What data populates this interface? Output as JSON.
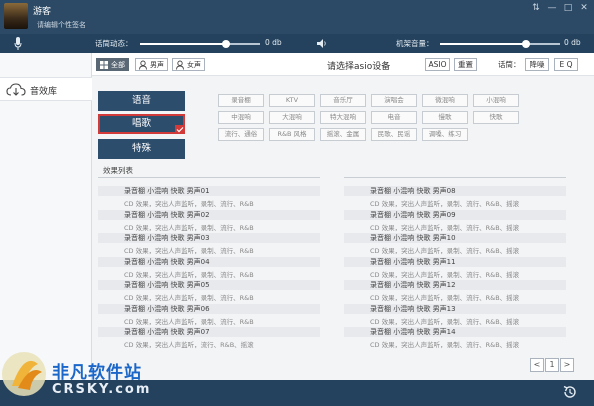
{
  "user": {
    "name": "游客",
    "signature": "请编辑个性签名"
  },
  "window_controls": [
    "⇅",
    "—",
    "□",
    "✕"
  ],
  "controls": {
    "reverb_label": "话筒动态：",
    "reverb_value": "0 db",
    "reverb_level": 0.72,
    "machine_label": "机架音量：",
    "machine_value": "0 db",
    "machine_level": 0.72
  },
  "sidebar": {
    "item_label": "音效库"
  },
  "filters": [
    {
      "label": "全部",
      "active": true,
      "icon": "all-icon"
    },
    {
      "label": "男声",
      "active": false,
      "icon": "male-icon"
    },
    {
      "label": "女声",
      "active": false,
      "icon": "female-icon"
    }
  ],
  "toolbar": {
    "asio_title": "请选择asio设备",
    "asio_button": "ASIO",
    "reset_button": "重置",
    "mic_label": "话筒：",
    "noise_button": "降噪",
    "eq_button": "E Q"
  },
  "categories": [
    {
      "label": "语音",
      "selected": false
    },
    {
      "label": "唱歌",
      "selected": true
    },
    {
      "label": "特殊",
      "selected": false
    }
  ],
  "tags": [
    [
      "录音棚",
      "KTV",
      "音乐厅",
      "演唱会",
      "微混响",
      "小混响"
    ],
    [
      "中混响",
      "大混响",
      "特大混响",
      "电音",
      "慢歌",
      "快歌"
    ],
    [
      "流行、通俗",
      "R&B 风格",
      "摇滚、金属",
      "民歌、民谣",
      "调嗓、练习"
    ]
  ],
  "list_title": "效果列表",
  "effects_left": [
    {
      "title": "录音棚 小混响 快歌 男声01",
      "desc": "CD 效果，突出人声监听，录制、流行、R&B"
    },
    {
      "title": "录音棚 小混响 快歌 男声02",
      "desc": "CD 效果，突出人声监听，录制、流行、R&B"
    },
    {
      "title": "录音棚 小混响 快歌 男声03",
      "desc": "CD 效果，突出人声监听，录制、流行、R&B"
    },
    {
      "title": "录音棚 小混响 快歌 男声04",
      "desc": "CD 效果，突出人声监听，录制、流行、R&B"
    },
    {
      "title": "录音棚 小混响 快歌 男声05",
      "desc": "CD 效果，突出人声监听，录制、流行、R&B"
    },
    {
      "title": "录音棚 小混响 快歌 男声06",
      "desc": "CD 效果，突出人声监听，录制、流行、R&B"
    },
    {
      "title": "录音棚 小混响 快歌 男声07",
      "desc": "CD 效果，突出人声监听，流行、R&B、摇滚"
    }
  ],
  "effects_right": [
    {
      "title": "录音棚 小混响 快歌 男声08",
      "desc": "CD 效果，突出人声监听，录制、流行、R&B、摇滚"
    },
    {
      "title": "录音棚 小混响 快歌 男声09",
      "desc": "CD 效果，突出人声监听，录制、流行、R&B、摇滚"
    },
    {
      "title": "录音棚 小混响 快歌 男声10",
      "desc": "CD 效果，突出人声监听，录制、流行、R&B、摇滚"
    },
    {
      "title": "录音棚 小混响 快歌 男声11",
      "desc": "CD 效果，突出人声监听，录制、流行、R&B、摇滚"
    },
    {
      "title": "录音棚 小混响 快歌 男声12",
      "desc": "CD 效果，突出人声监听，录制、流行、R&B、摇滚"
    },
    {
      "title": "录音棚 小混响 快歌 男声13",
      "desc": "CD 效果，突出人声监听，录制、流行、R&B、摇滚"
    },
    {
      "title": "录音棚 小混响 快歌 男声14",
      "desc": "CD 效果，突出人声监听，录制、流行、R&B、摇滚"
    }
  ],
  "pager": {
    "prev": "<",
    "page": "1",
    "next": ">"
  },
  "watermark": {
    "text": "非凡软件站",
    "sub": "CRSKY.com"
  },
  "colors": {
    "header": "#2c4a66",
    "accent": "#2d4d6d",
    "selected_border": "#d23a3a"
  }
}
